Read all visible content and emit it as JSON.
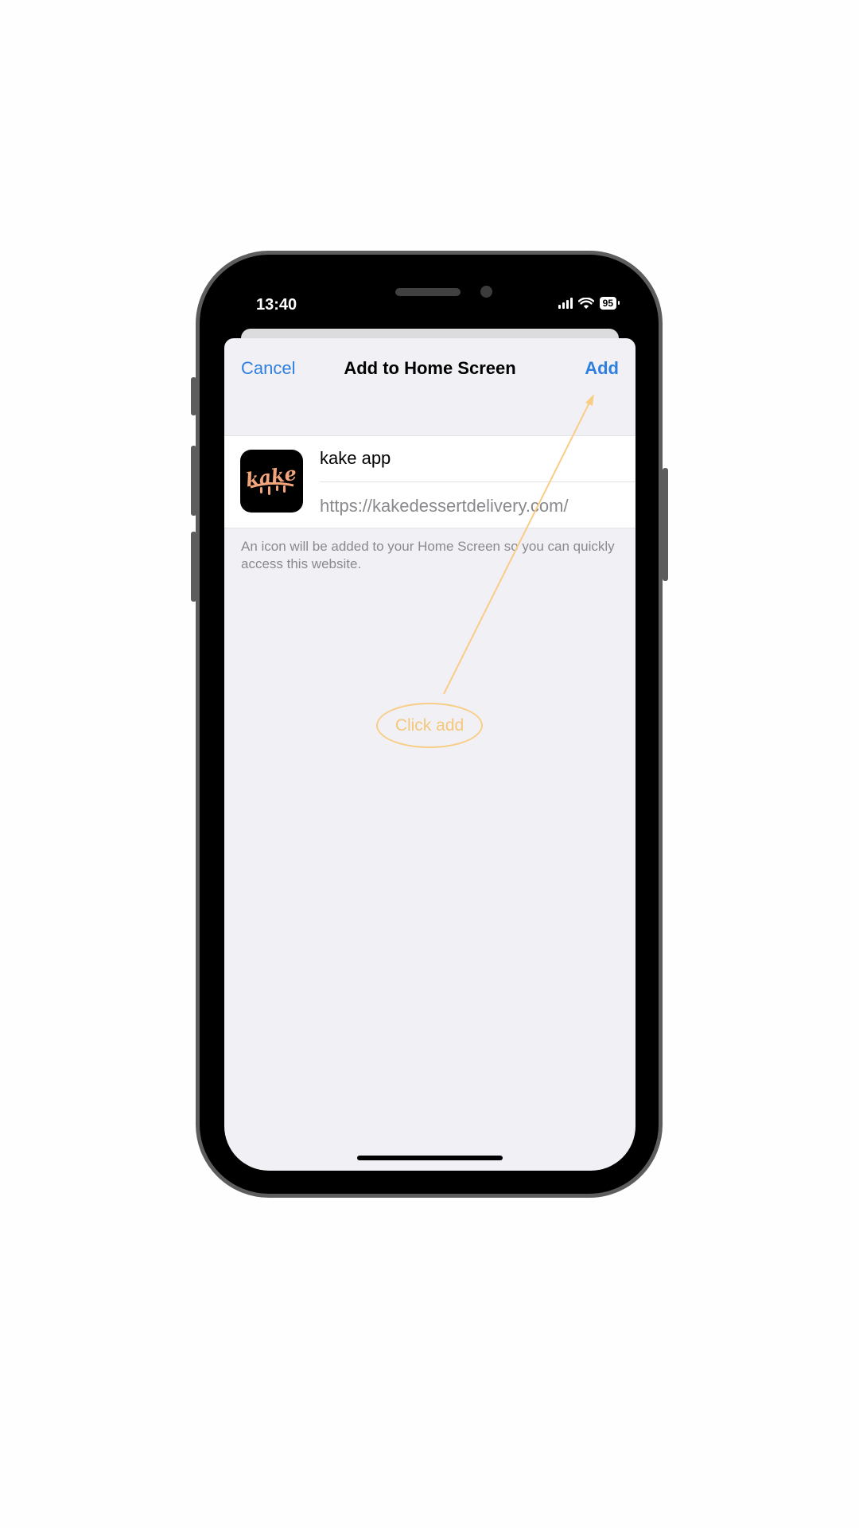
{
  "status_bar": {
    "time": "13:40",
    "battery": "95"
  },
  "sheet": {
    "cancel_label": "Cancel",
    "title": "Add to Home Screen",
    "add_label": "Add",
    "app_name": "kake app",
    "url": "https://kakedessertdelivery.com/",
    "note": "An icon will be added to your Home Screen so you can quickly access this website.",
    "icon_logo_text": "kake"
  },
  "annotation": {
    "text": "Click add"
  },
  "colors": {
    "accent": "#2f7fe0",
    "annotation": "#f8ce86",
    "logo": "#f2a57a"
  },
  "icons": [
    "signal-icon",
    "wifi-icon",
    "battery-icon",
    "app-icon"
  ]
}
